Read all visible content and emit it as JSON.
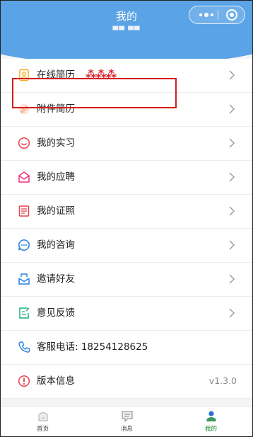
{
  "nav": {
    "title": "我的",
    "user_name": "▀▀ ▀▀"
  },
  "menu": {
    "items": [
      {
        "label": "在线简历",
        "redacted": "⁂⁂⁂",
        "icon": "resume-icon"
      },
      {
        "label": "附件简历",
        "icon": "attachment-icon"
      },
      {
        "label": "我的实习",
        "icon": "internship-icon"
      },
      {
        "label": "我的应聘",
        "icon": "application-inbox-icon"
      },
      {
        "label": "我的证照",
        "icon": "certificate-icon"
      },
      {
        "label": "我的咨询",
        "icon": "chat-icon"
      },
      {
        "label": "邀请好友",
        "icon": "invite-icon"
      },
      {
        "label": "意见反馈",
        "icon": "feedback-icon"
      },
      {
        "label": "客服电话: 18254128625",
        "icon": "phone-icon"
      },
      {
        "label": "版本信息",
        "value": "v1.3.0",
        "icon": "info-icon"
      }
    ]
  },
  "tabbar": {
    "tabs": [
      {
        "label": "首页",
        "icon": "home-icon"
      },
      {
        "label": "消息",
        "icon": "message-icon"
      },
      {
        "label": "我的",
        "icon": "profile-icon",
        "active": true
      }
    ]
  },
  "colors": {
    "header": "#5aa3e6",
    "highlight": "#d41b1b",
    "active_tab": "#1a8e2e"
  }
}
